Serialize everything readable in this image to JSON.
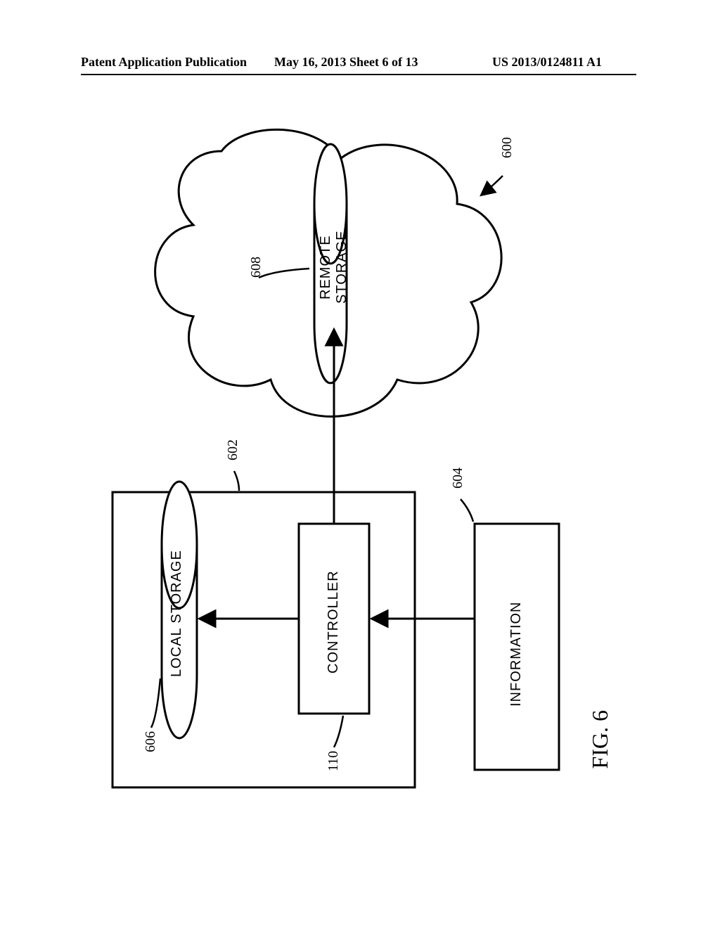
{
  "header": {
    "left": "Patent Application Publication",
    "mid": "May 16, 2013  Sheet 6 of 13",
    "right": "US 2013/0124811 A1"
  },
  "refs": {
    "system": "600",
    "device": "602",
    "info": "604",
    "local": "606",
    "remote": "608",
    "controller": "110"
  },
  "labels": {
    "remote_storage_l1": "REMOTE",
    "remote_storage_l2": "STORAGE",
    "local_storage": "LOCAL STORAGE",
    "controller": "CONTROLLER",
    "information": "INFORMATION"
  },
  "caption": "FIG. 6"
}
